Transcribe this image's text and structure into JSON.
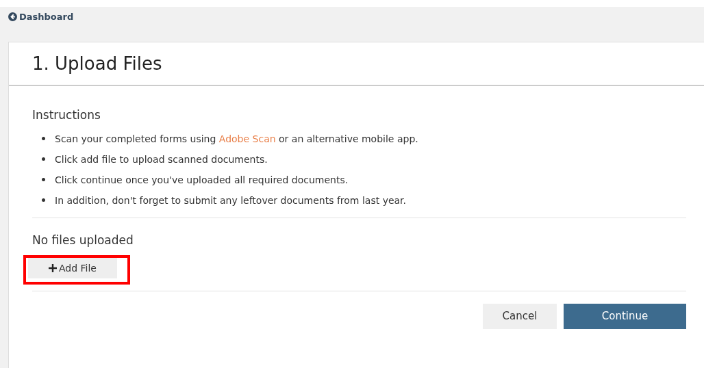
{
  "back_link": {
    "label": "Dashboard"
  },
  "card": {
    "title": "1. Upload Files",
    "instructions": {
      "heading": "Instructions",
      "items": [
        [
          {
            "text": "Scan your completed forms using ",
            "link": false
          },
          {
            "text": "Adobe Scan",
            "link": true
          },
          {
            "text": " or an alternative mobile app.",
            "link": false
          }
        ],
        [
          {
            "text": "Click add file to upload scanned documents.",
            "link": false
          }
        ],
        [
          {
            "text": "Click continue once you've uploaded all required documents.",
            "link": false
          }
        ],
        [
          {
            "text": "In addition, don't forget to submit any leftover documents from last year.",
            "link": false
          }
        ]
      ]
    },
    "files_status": "No files uploaded",
    "add_button": {
      "label": "Add File",
      "highlighted": true
    },
    "buttons": [
      {
        "label": "Cancel",
        "kind": "secondary"
      },
      {
        "label": "Continue",
        "kind": "primary"
      }
    ]
  }
}
